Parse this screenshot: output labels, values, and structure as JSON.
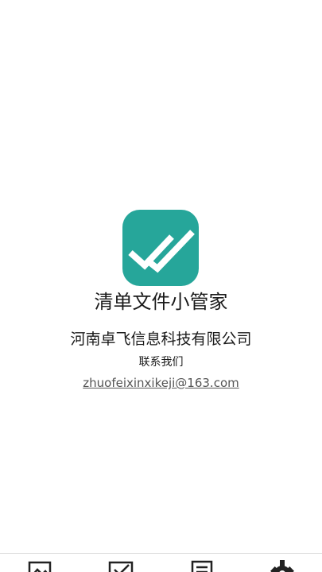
{
  "app": {
    "name": "清单文件小管家",
    "logo_icon": "double-check-icon",
    "logo_color": "#26a69a"
  },
  "company": {
    "name": "河南卓飞信息科技有限公司"
  },
  "contact": {
    "label": "联系我们",
    "email": "zhuofeixinxikeji@163.com"
  },
  "bottom_nav": {
    "items": [
      {
        "icon": "image-icon"
      },
      {
        "icon": "checkbox-icon"
      },
      {
        "icon": "document-icon"
      },
      {
        "icon": "gear-icon"
      }
    ]
  }
}
